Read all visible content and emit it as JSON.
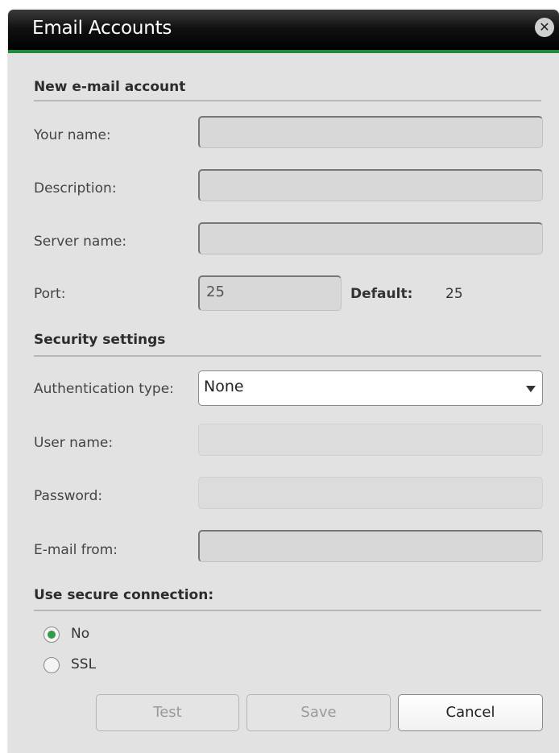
{
  "window": {
    "title": "Email Accounts",
    "close_icon": "close-icon"
  },
  "new_account": {
    "heading": "New e-mail account",
    "your_name": {
      "label": "Your name:",
      "value": ""
    },
    "description": {
      "label": "Description:",
      "value": ""
    },
    "server_name": {
      "label": "Server name:",
      "value": ""
    },
    "port": {
      "label": "Port:",
      "value": "25",
      "default_label": "Default:",
      "default_value": "25"
    }
  },
  "security": {
    "heading": "Security settings",
    "auth_type": {
      "label": "Authentication type:",
      "value": "None"
    },
    "user_name": {
      "label": "User name:",
      "value": ""
    },
    "password": {
      "label": "Password:",
      "value": ""
    },
    "email_from": {
      "label": "E-mail from:",
      "value": ""
    }
  },
  "secure_connection": {
    "heading": "Use secure connection:",
    "options": [
      {
        "label": "No",
        "selected": true
      },
      {
        "label": "SSL",
        "selected": false
      }
    ]
  },
  "buttons": {
    "test": "Test",
    "save": "Save",
    "cancel": "Cancel"
  },
  "colors": {
    "accent": "#1f8a3a",
    "titlebar": "#000000",
    "radio_selected": "#2e9d45"
  }
}
